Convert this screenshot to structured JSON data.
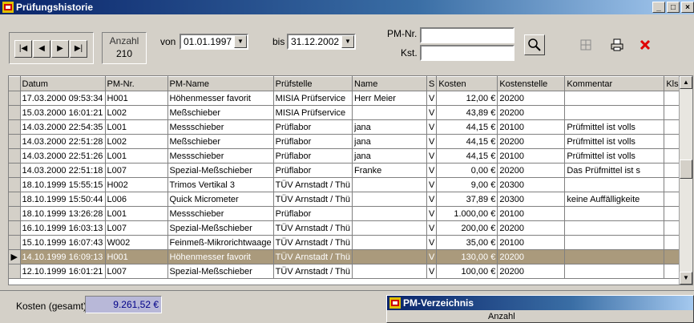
{
  "window": {
    "title": "Prüfungshistorie",
    "controls": [
      "_",
      "□",
      "×"
    ]
  },
  "toolbar": {
    "anzahl_label": "Anzahl",
    "anzahl_value": "210",
    "von_label": "von",
    "von_value": "01.01.1997",
    "bis_label": "bis",
    "bis_value": "31.12.2002",
    "pmnr_label": "PM-Nr.",
    "pmnr_value": "",
    "kst_label": "Kst.",
    "kst_value": "",
    "nav_icons": [
      "first-record-icon",
      "previous-record-icon",
      "next-record-icon",
      "last-record-icon"
    ]
  },
  "table": {
    "columns": [
      "Datum",
      "PM-Nr.",
      "PM-Name",
      "Prüfstelle",
      "Name",
      "S",
      "Kosten",
      "Kostenstelle",
      "Kommentar",
      "Kls."
    ],
    "rows": [
      [
        "17.03.2000 09:53:34",
        "H001",
        "Höhenmesser favorit",
        "MISIA Prüfservice",
        "Herr Meier",
        "V",
        "12,00 €",
        "20200",
        "",
        ""
      ],
      [
        "15.03.2000 16:01:21",
        "L002",
        "Meßschieber",
        "MISIA Prüfservice",
        "",
        "V",
        "43,89 €",
        "20200",
        "",
        ""
      ],
      [
        "14.03.2000 22:54:35",
        "L001",
        "Messschieber",
        "Prüflabor",
        "jana",
        "V",
        "44,15 €",
        "20100",
        "Prüfmittel ist volls",
        ""
      ],
      [
        "14.03.2000 22:51:28",
        "L002",
        "Meßschieber",
        "Prüflabor",
        "jana",
        "V",
        "44,15 €",
        "20200",
        "Prüfmittel ist volls",
        ""
      ],
      [
        "14.03.2000 22:51:26",
        "L001",
        "Messschieber",
        "Prüflabor",
        "jana",
        "V",
        "44,15 €",
        "20100",
        "Prüfmittel ist volls",
        ""
      ],
      [
        "14.03.2000 22:51:18",
        "L007",
        "Spezial-Meßschieber",
        "Prüflabor",
        "Franke",
        "V",
        "0,00 €",
        "20200",
        "Das Prüfmittel ist s",
        ""
      ],
      [
        "18.10.1999 15:55:15",
        "H002",
        "Trimos Vertikal 3",
        "TÜV Arnstadt / Thü",
        "",
        "V",
        "9,00 €",
        "20300",
        "",
        ""
      ],
      [
        "18.10.1999 15:50:44",
        "L006",
        "Quick Micrometer",
        "TÜV Arnstadt / Thü",
        "",
        "V",
        "37,89 €",
        "20300",
        "keine Auffälligkeite",
        ""
      ],
      [
        "18.10.1999 13:26:28",
        "L001",
        "Messschieber",
        "Prüflabor",
        "",
        "V",
        "1.000,00 €",
        "20100",
        "",
        ""
      ],
      [
        "16.10.1999 16:03:13",
        "L007",
        "Spezial-Meßschieber",
        "TÜV Arnstadt / Thü",
        "",
        "V",
        "200,00 €",
        "20200",
        "",
        ""
      ],
      [
        "15.10.1999 16:07:43",
        "W002",
        "Feinmeß-Mikrorichtwaage",
        "TÜV Arnstadt / Thü",
        "",
        "V",
        "35,00 €",
        "20100",
        "",
        ""
      ],
      [
        "14.10.1999 16:09:13",
        "H001",
        "Höhenmesser favorit",
        "TÜV Arnstadt / Thü",
        "",
        "V",
        "130,00 €",
        "20200",
        "",
        ""
      ],
      [
        "12.10.1999 16:01:21",
        "L007",
        "Spezial-Meßschieber",
        "TÜV Arnstadt / Thü",
        "",
        "V",
        "100,00 €",
        "20200",
        "",
        ""
      ]
    ],
    "selected_row": 11
  },
  "footer": {
    "kosten_label": "Kosten (gesamt)",
    "kosten_value": "9.261,52 €"
  },
  "subwindow": {
    "title": "PM-Verzeichnis",
    "anzahl_label": "Anzahl"
  },
  "colors": {
    "title_start": "#0a246a",
    "selection": "#aa9a7c",
    "delete_red": "#e00000"
  }
}
